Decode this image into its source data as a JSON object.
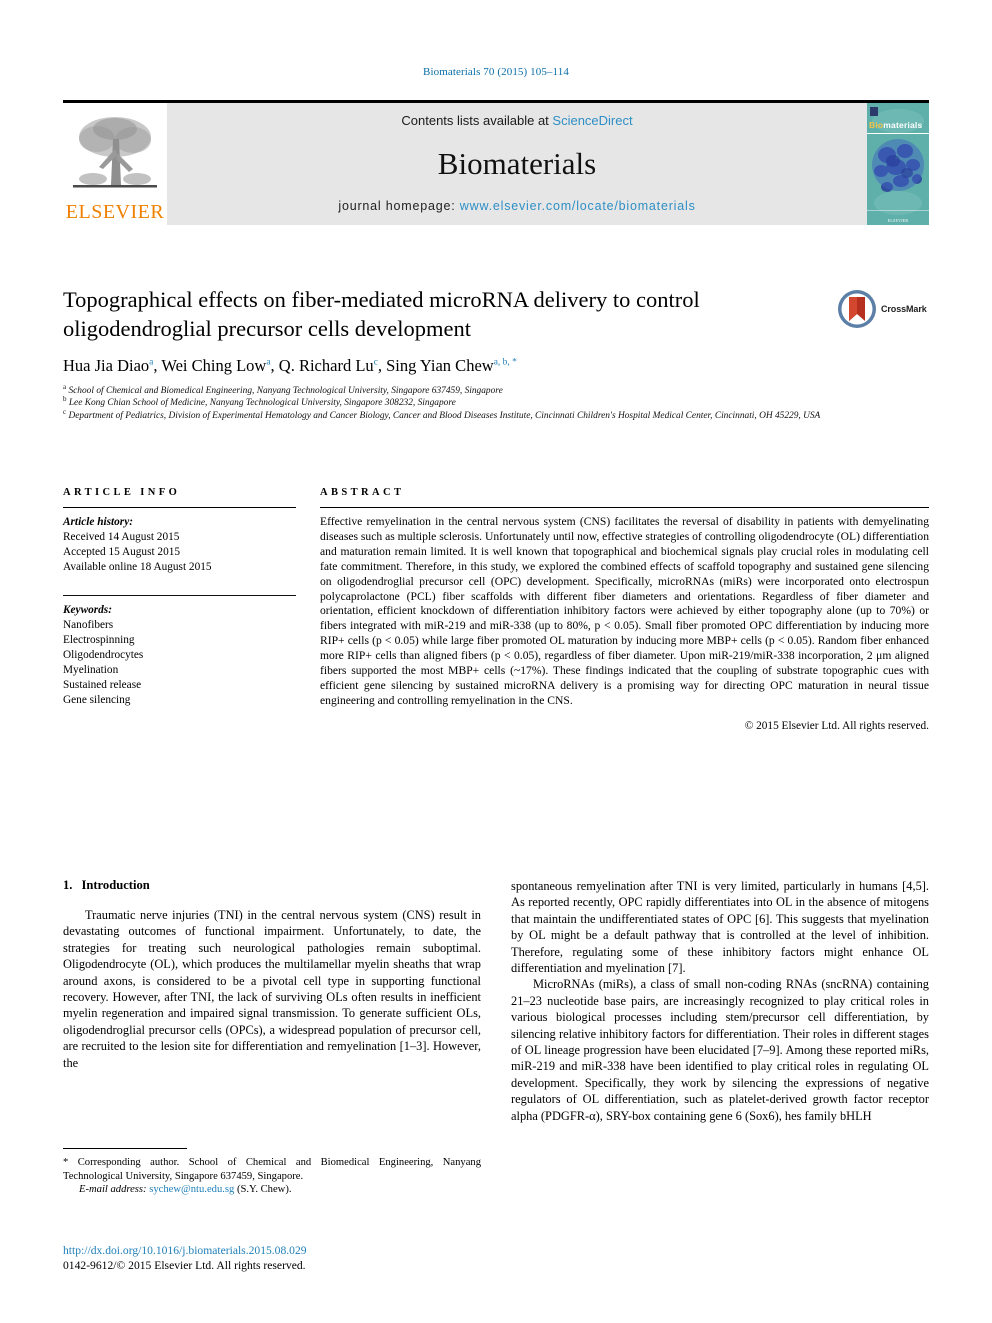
{
  "running_head": "Biomaterials 70 (2015) 105–114",
  "masthead": {
    "contents_prefix": "Contents lists available at ",
    "contents_link": "ScienceDirect",
    "journal_name": "Biomaterials",
    "homepage_prefix": "journal homepage: ",
    "homepage_url": "www.elsevier.com/locate/biomaterials",
    "publisher": "ELSEVIER",
    "cover": {
      "title_bio": "Bio",
      "title_rest": "materials",
      "footer": "ELSEVIER"
    }
  },
  "article": {
    "title": "Topographical effects on fiber-mediated microRNA delivery to control oligodendroglial precursor cells development",
    "crossmark_label": "CrossMark",
    "authors": [
      {
        "name": "Hua Jia Diao",
        "marks": "a",
        "sep": ", "
      },
      {
        "name": "Wei Ching Low",
        "marks": "a",
        "sep": ", "
      },
      {
        "name": "Q. Richard Lu",
        "marks": "c",
        "sep": ", "
      },
      {
        "name": "Sing Yian Chew",
        "marks": "a, b, *",
        "sep": ""
      }
    ],
    "affiliations": [
      {
        "mark": "a",
        "text": "School of Chemical and Biomedical Engineering, Nanyang Technological University, Singapore 637459, Singapore"
      },
      {
        "mark": "b",
        "text": "Lee Kong Chian School of Medicine, Nanyang Technological University, Singapore 308232, Singapore"
      },
      {
        "mark": "c",
        "text": "Department of Pediatrics, Division of Experimental Hematology and Cancer Biology, Cancer and Blood Diseases Institute, Cincinnati Children's Hospital Medical Center, Cincinnati, OH 45229, USA"
      }
    ]
  },
  "article_info": {
    "heading": "ARTICLE INFO",
    "history_label": "Article history:",
    "history": [
      "Received 14 August 2015",
      "Accepted 15 August 2015",
      "Available online 18 August 2015"
    ],
    "keywords_label": "Keywords:",
    "keywords": [
      "Nanofibers",
      "Electrospinning",
      "Oligodendrocytes",
      "Myelination",
      "Sustained release",
      "Gene silencing"
    ]
  },
  "abstract": {
    "heading": "ABSTRACT",
    "text": "Effective remyelination in the central nervous system (CNS) facilitates the reversal of disability in patients with demyelinating diseases such as multiple sclerosis. Unfortunately until now, effective strategies of controlling oligodendrocyte (OL) differentiation and maturation remain limited. It is well known that topographical and biochemical signals play crucial roles in modulating cell fate commitment. Therefore, in this study, we explored the combined effects of scaffold topography and sustained gene silencing on oligodendroglial precursor cell (OPC) development. Specifically, microRNAs (miRs) were incorporated onto electrospun polycaprolactone (PCL) fiber scaffolds with different fiber diameters and orientations. Regardless of fiber diameter and orientation, efficient knockdown of differentiation inhibitory factors were achieved by either topography alone (up to 70%) or fibers integrated with miR-219 and miR-338 (up to 80%, p < 0.05). Small fiber promoted OPC differentiation by inducing more RIP+ cells (p < 0.05) while large fiber promoted OL maturation by inducing more MBP+ cells (p < 0.05). Random fiber enhanced more RIP+ cells than aligned fibers (p < 0.05), regardless of fiber diameter. Upon miR-219/miR-338 incorporation, 2 μm aligned fibers supported the most MBP+ cells (~17%). These findings indicated that the coupling of substrate topographic cues with efficient gene silencing by sustained microRNA delivery is a promising way for directing OPC maturation in neural tissue engineering and controlling remyelination in the CNS.",
    "copyright": "© 2015 Elsevier Ltd. All rights reserved."
  },
  "introduction": {
    "number": "1.",
    "heading": "Introduction",
    "left_paragraphs": [
      "Traumatic nerve injuries (TNI) in the central nervous system (CNS) result in devastating outcomes of functional impairment. Unfortunately, to date, the strategies for treating such neurological pathologies remain suboptimal. Oligodendrocyte (OL), which produces the multilamellar myelin sheaths that wrap around axons, is considered to be a pivotal cell type in supporting functional recovery. However, after TNI, the lack of surviving OLs often results in inefficient myelin regeneration and impaired signal transmission. To generate sufficient OLs, oligodendroglial precursor cells (OPCs), a widespread population of precursor cell, are recruited to the lesion site for differentiation and remyelination [1–3]. However, the"
    ],
    "right_paragraphs": [
      "spontaneous remyelination after TNI is very limited, particularly in humans [4,5]. As reported recently, OPC rapidly differentiates into OL in the absence of mitogens that maintain the undifferentiated states of OPC [6]. This suggests that myelination by OL might be a default pathway that is controlled at the level of inhibition. Therefore, regulating some of these inhibitory factors might enhance OL differentiation and myelination [7].",
      "MicroRNAs (miRs), a class of small non-coding RNAs (sncRNA) containing 21–23 nucleotide base pairs, are increasingly recognized to play critical roles in various biological processes including stem/precursor cell differentiation, by silencing relative inhibitory factors for differentiation. Their roles in different stages of OL lineage progression have been elucidated [7–9]. Among these reported miRs, miR-219 and miR-338 have been identified to play critical roles in regulating OL development. Specifically, they work by silencing the expressions of negative regulators of OL differentiation, such as platelet-derived growth factor receptor alpha (PDGFR-α), SRY-box containing gene 6 (Sox6), hes family bHLH"
    ]
  },
  "footnote": {
    "corresponding": "* Corresponding author. School of Chemical and Biomedical Engineering, Nanyang Technological University, Singapore 637459, Singapore.",
    "email_label": "E-mail address:",
    "email": "sychew@ntu.edu.sg",
    "email_suffix": "(S.Y. Chew)."
  },
  "doi": {
    "url": "http://dx.doi.org/10.1016/j.biomaterials.2015.08.029",
    "issn_line": "0142-9612/© 2015 Elsevier Ltd. All rights reserved."
  },
  "colors": {
    "link": "#1f7fb8",
    "header": "#0b6ea8",
    "elsevier_orange": "#f08000",
    "masthead_gray": "#e6e6e6",
    "cover_teal": "#5fb0aa"
  }
}
